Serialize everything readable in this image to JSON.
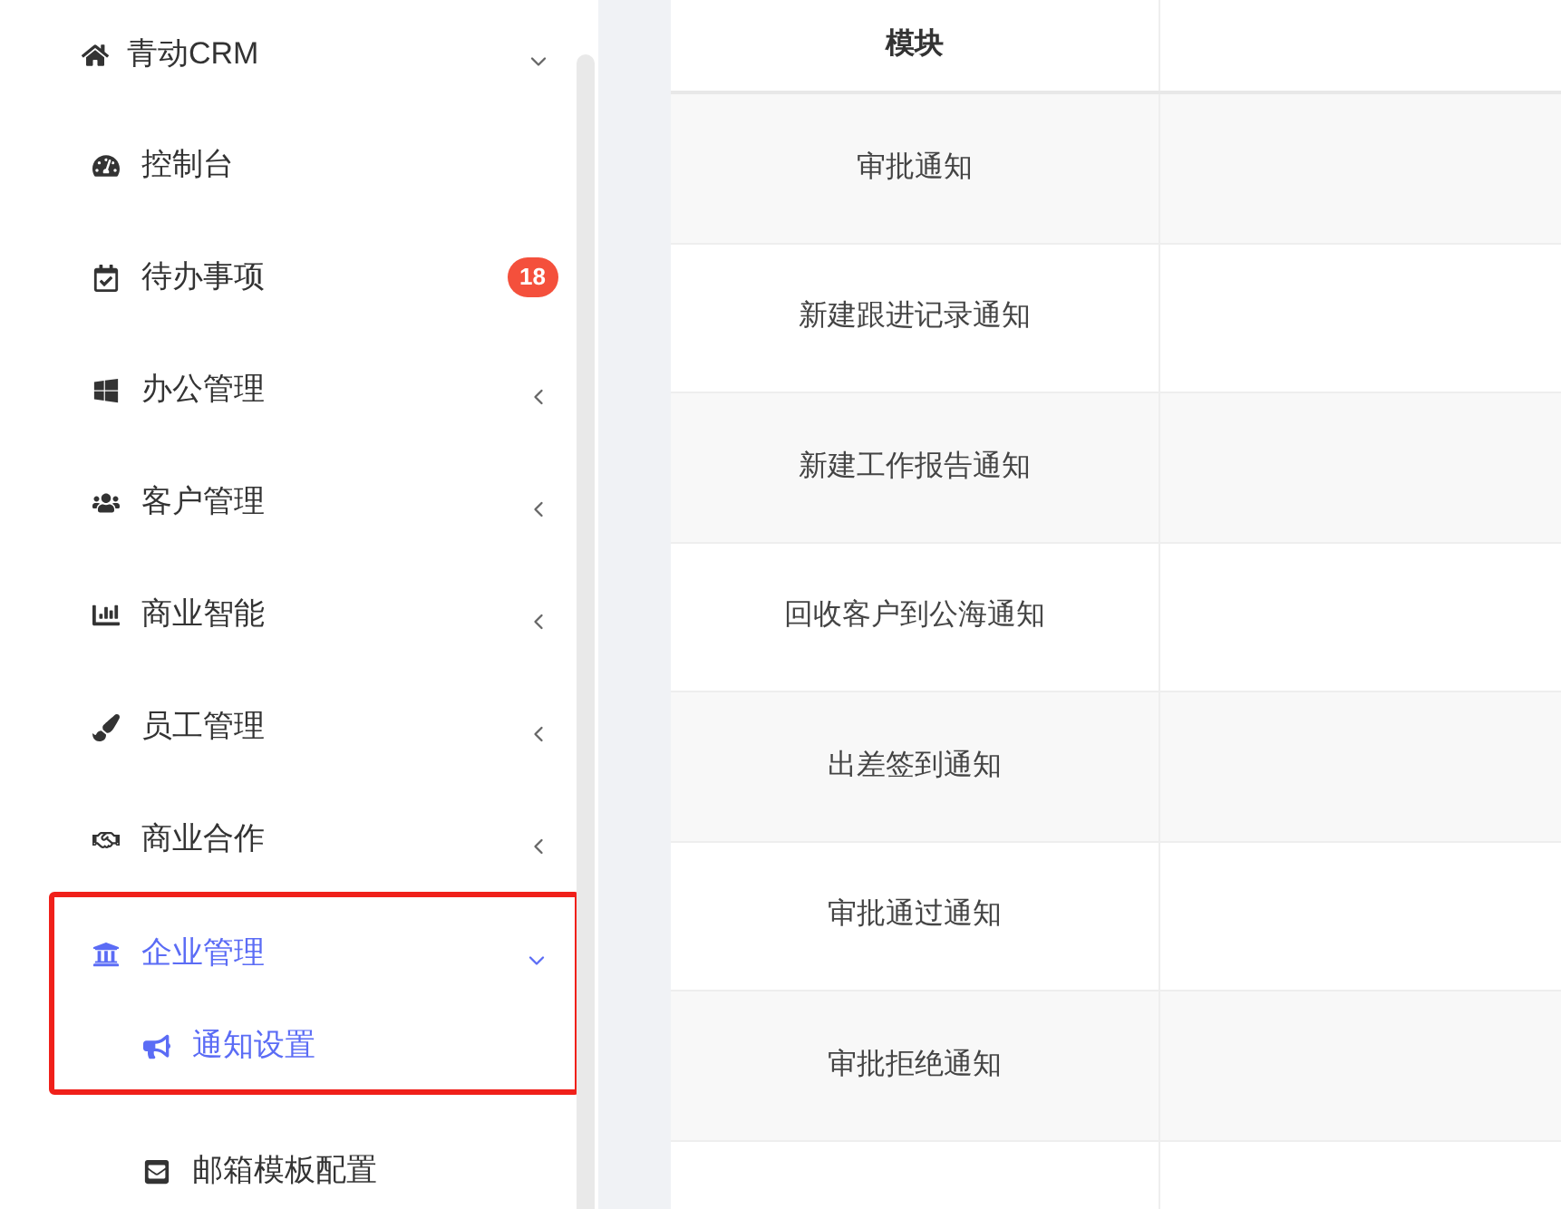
{
  "sidebar": {
    "items": [
      {
        "label": "青动CRM",
        "expanded": true,
        "children": [
          {
            "label": "控制台"
          },
          {
            "label": "待办事项",
            "badge": "18"
          },
          {
            "label": "办公管理",
            "expanded": false
          },
          {
            "label": "客户管理",
            "expanded": false
          },
          {
            "label": "商业智能",
            "expanded": false
          },
          {
            "label": "员工管理",
            "expanded": false
          },
          {
            "label": "商业合作",
            "expanded": false
          },
          {
            "label": "企业管理",
            "expanded": true,
            "selected": true,
            "annotated": true,
            "children": [
              {
                "label": "通知设置",
                "selected": true,
                "annotated": true
              },
              {
                "label": "邮箱模板配置",
                "selected": false,
                "annotated": false
              }
            ]
          }
        ]
      }
    ]
  },
  "table": {
    "columns": [
      "模块"
    ],
    "rows": [
      {
        "cells": [
          "审批通知"
        ]
      },
      {
        "cells": [
          "新建跟进记录通知"
        ]
      },
      {
        "cells": [
          "新建工作报告通知"
        ]
      },
      {
        "cells": [
          "回收客户到公海通知"
        ]
      },
      {
        "cells": [
          "出差签到通知"
        ]
      },
      {
        "cells": [
          "审批通过通知"
        ]
      },
      {
        "cells": [
          "审批拒绝通知"
        ]
      }
    ]
  }
}
